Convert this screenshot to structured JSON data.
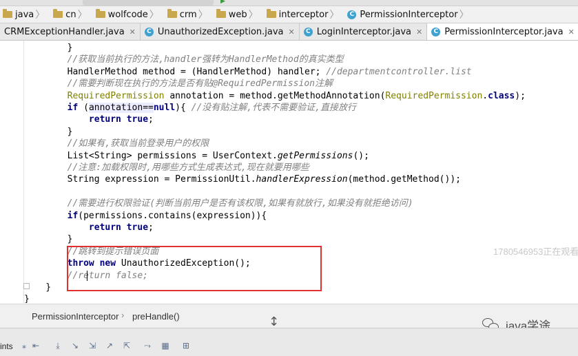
{
  "navigation": {
    "crumbs": [
      "java",
      "cn",
      "wolfcode",
      "crm",
      "web",
      "interceptor",
      "PermissionInterceptor"
    ]
  },
  "tabs": [
    {
      "label": "CRMExceptionHandler.java",
      "active": false
    },
    {
      "label": "UnauthorizedException.java",
      "active": false
    },
    {
      "label": "LoginInterceptor.java",
      "active": false
    },
    {
      "label": "PermissionInterceptor.java",
      "active": true
    }
  ],
  "code_lines": [
    [
      {
        "t": "        }",
        "c": "plain"
      }
    ],
    [
      {
        "t": "        //获取当前执行的方法,",
        "c": "cm"
      },
      {
        "t": "handler",
        "c": "cm"
      },
      {
        "t": "强转为",
        "c": "cm"
      },
      {
        "t": "HandlerMethod",
        "c": "cm"
      },
      {
        "t": "的真实类型",
        "c": "cm"
      }
    ],
    [
      {
        "t": "        HandlerMethod method = (HandlerMethod) handler; ",
        "c": "plain"
      },
      {
        "t": "//departmentcontroller.list",
        "c": "cm"
      }
    ],
    [
      {
        "t": "        //需要判断现在执行的方法是否有贴",
        "c": "cm"
      },
      {
        "t": "@RequiredPermission",
        "c": "cm"
      },
      {
        "t": "注解",
        "c": "cm"
      }
    ],
    [
      {
        "t": "        RequiredPermission",
        "c": "an"
      },
      {
        "t": " annotation = method.getMethodAnnotation(",
        "c": "plain"
      },
      {
        "t": "RequiredPermission",
        "c": "an"
      },
      {
        "t": ".",
        "c": "plain"
      },
      {
        "t": "class",
        "c": "kw"
      },
      {
        "t": ");",
        "c": "plain"
      }
    ],
    [
      {
        "t": "        ",
        "c": "plain"
      },
      {
        "t": "if",
        "c": "kw"
      },
      {
        "t": " (",
        "c": "plain"
      },
      {
        "t": "annotation==",
        "c": "hl"
      },
      {
        "t": "null",
        "c": "kw"
      },
      {
        "t": "){ ",
        "c": "plain"
      },
      {
        "t": "//没有贴注解,代表不需要验证,直接放行",
        "c": "cm"
      }
    ],
    [
      {
        "t": "            ",
        "c": "plain"
      },
      {
        "t": "return true",
        "c": "kw"
      },
      {
        "t": ";",
        "c": "plain"
      }
    ],
    [
      {
        "t": "        }",
        "c": "plain"
      }
    ],
    [
      {
        "t": "        //如果有,获取当前登录用户的权限",
        "c": "cm"
      }
    ],
    [
      {
        "t": "        List<String> permissions = UserContext.",
        "c": "plain"
      },
      {
        "t": "getPermissions",
        "c": "it"
      },
      {
        "t": "();",
        "c": "plain"
      }
    ],
    [
      {
        "t": "        //注意:加载权限时,用哪些方式生成表达式,现在就要用哪些",
        "c": "cm"
      }
    ],
    [
      {
        "t": "        String expression = PermissionUtil.",
        "c": "plain"
      },
      {
        "t": "handlerExpression",
        "c": "it"
      },
      {
        "t": "(method.getMethod());",
        "c": "plain"
      }
    ],
    [
      {
        "t": "",
        "c": "plain"
      }
    ],
    [
      {
        "t": "        //需要进行权限验证(判断当前用户是否有该权限,如果有就放行,如果没有就拒绝访问)",
        "c": "cm"
      }
    ],
    [
      {
        "t": "        ",
        "c": "plain"
      },
      {
        "t": "if",
        "c": "kw"
      },
      {
        "t": "(permissions.contains(expression)){",
        "c": "plain"
      }
    ],
    [
      {
        "t": "            ",
        "c": "plain"
      },
      {
        "t": "return true",
        "c": "kw"
      },
      {
        "t": ";",
        "c": "plain"
      }
    ],
    [
      {
        "t": "        }",
        "c": "plain"
      }
    ],
    [
      {
        "t": "        //跳转到提示错误页面",
        "c": "cm"
      }
    ],
    [
      {
        "t": "        ",
        "c": "plain"
      },
      {
        "t": "throw new",
        "c": "kw"
      },
      {
        "t": " UnauthorizedException();",
        "c": "plain"
      }
    ],
    [
      {
        "t": "        //return false;",
        "c": "cm"
      }
    ],
    [
      {
        "t": "    }",
        "c": "plain"
      }
    ],
    [
      {
        "t": "}",
        "c": "plain"
      }
    ]
  ],
  "viewer_watermark": "1780546953正在观看(",
  "status": {
    "class_name": "PermissionInterceptor",
    "method_name": "preHandle()"
  },
  "watermark": {
    "text": "java学途",
    "icon": "wechat-icon"
  },
  "bottom": {
    "label": "ints"
  }
}
